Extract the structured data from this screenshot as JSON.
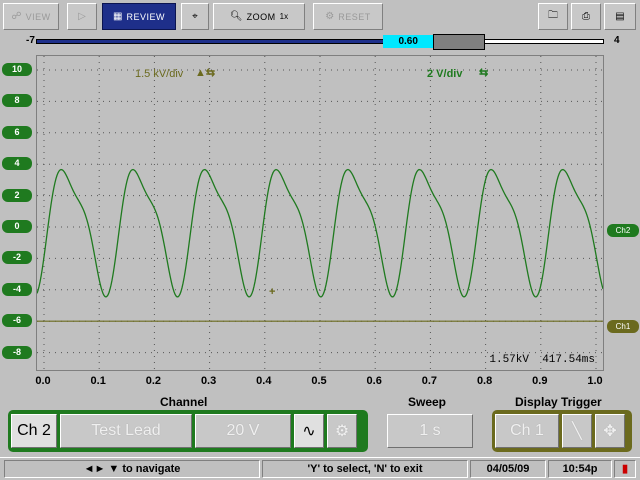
{
  "toolbar": {
    "view_label": "VIEW",
    "review_label": "REVIEW",
    "zoom_label": "ZOOM",
    "zoom_level": "1x",
    "reset_label": "RESET"
  },
  "slider": {
    "min": "-7",
    "max": "4",
    "value": "0.60",
    "fraction": 0.7
  },
  "plot": {
    "ch1_scale": "1.5 kV/div",
    "ch2_scale": "2 V/div",
    "readout_voltage": "1.57kV",
    "readout_time": "417.54ms",
    "y_ticks": [
      "10",
      "8",
      "6",
      "4",
      "2",
      "0",
      "-2",
      "-4",
      "-6",
      "-8"
    ],
    "x_ticks": [
      "0.0",
      "0.1",
      "0.2",
      "0.3",
      "0.4",
      "0.5",
      "0.6",
      "0.7",
      "0.8",
      "0.9",
      "1.0"
    ],
    "ch2_tag": "Ch2",
    "ch1_tag": "Ch1",
    "ch2_color": "#1f7a1f",
    "ch1_color": "#6b6a1e"
  },
  "controls": {
    "channel_title": "Channel",
    "sweep_title": "Sweep",
    "trigger_title": "Display Trigger",
    "channel_select": "Ch 2",
    "probe": "Test Lead",
    "range": "20 V",
    "sweep_value": "1 s",
    "trigger_channel": "Ch 1"
  },
  "status": {
    "navigate": "◄► ▼ to navigate",
    "select_hint": "'Y' to select, 'N' to exit",
    "date": "04/05/09",
    "time": "10:54p"
  }
}
